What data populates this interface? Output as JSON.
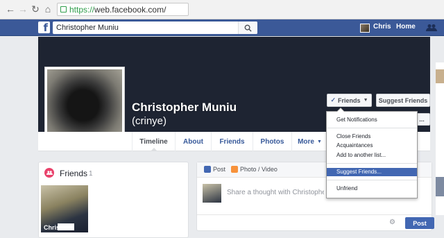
{
  "browser": {
    "url_protocol": "https://",
    "url_host": "web.facebook.com/"
  },
  "fbbar": {
    "logo": "f",
    "search_value": "Christopher Muniu",
    "user_name": "Chris",
    "home_label": "Home"
  },
  "profile": {
    "name": "Christopher Muniu",
    "alternate_name": "(crinye)",
    "friends_button": "Friends",
    "suggest_button": "Suggest Friends",
    "more_button": "..."
  },
  "tabs": [
    {
      "label": "Timeline"
    },
    {
      "label": "About"
    },
    {
      "label": "Friends"
    },
    {
      "label": "Photos"
    },
    {
      "label": "More"
    }
  ],
  "dropdown": {
    "items": [
      {
        "label": "Get Notifications"
      },
      {
        "label": "Close Friends"
      },
      {
        "label": "Acquaintances"
      },
      {
        "label": "Add to another list..."
      },
      {
        "label": "Suggest Friends..."
      },
      {
        "label": "Unfriend"
      }
    ],
    "highlighted_index": 4
  },
  "friends_card": {
    "title": "Friends",
    "count": "1",
    "friend_name": "Chris"
  },
  "composer": {
    "tab_post": "Post",
    "tab_photo": "Photo / Video",
    "placeholder": "Share a thought with Christopher",
    "post_button": "Post"
  },
  "colors": {
    "brand": "#3b5998",
    "highlight": "#4267b2",
    "friends_icon": "#e9426b"
  }
}
